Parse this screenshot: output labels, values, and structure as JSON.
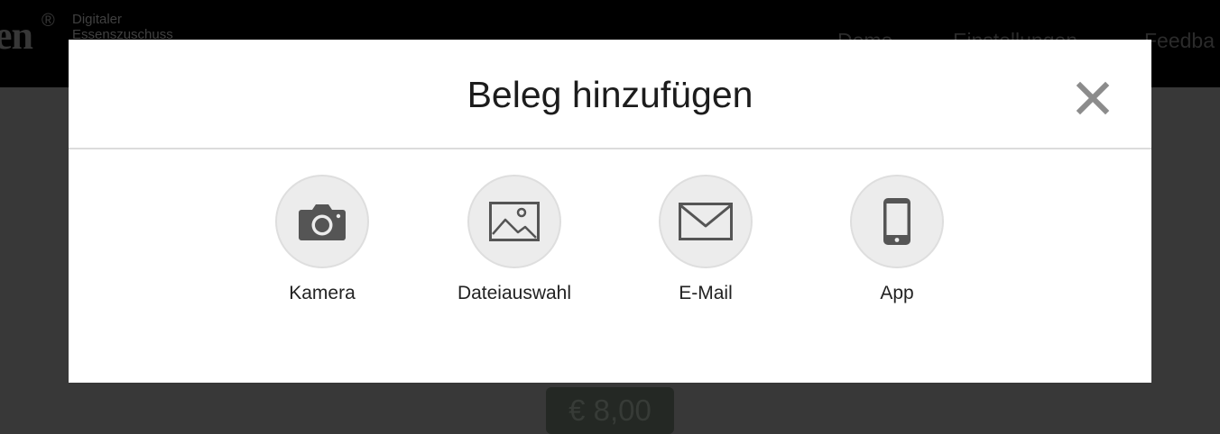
{
  "header": {
    "brand_mark": "en",
    "brand_reg": "®",
    "brand_tagline_1": "Digitaler",
    "brand_tagline_2": "Essenszuschuss",
    "nav": [
      "Demo",
      "Einstellungen",
      "Feedba"
    ]
  },
  "page": {
    "price": "€ 8,00"
  },
  "modal": {
    "title": "Beleg hinzufügen",
    "close_icon": "close-icon",
    "options": [
      {
        "label": "Kamera",
        "icon": "camera-icon"
      },
      {
        "label": "Dateiauswahl",
        "icon": "image-icon"
      },
      {
        "label": "E-Mail",
        "icon": "mail-icon"
      },
      {
        "label": "App",
        "icon": "smartphone-icon"
      }
    ]
  },
  "colors": {
    "icon": "#555555",
    "close": "#8c8c8c",
    "modal_background": "#ffffff",
    "option_circle": "#ececec"
  }
}
